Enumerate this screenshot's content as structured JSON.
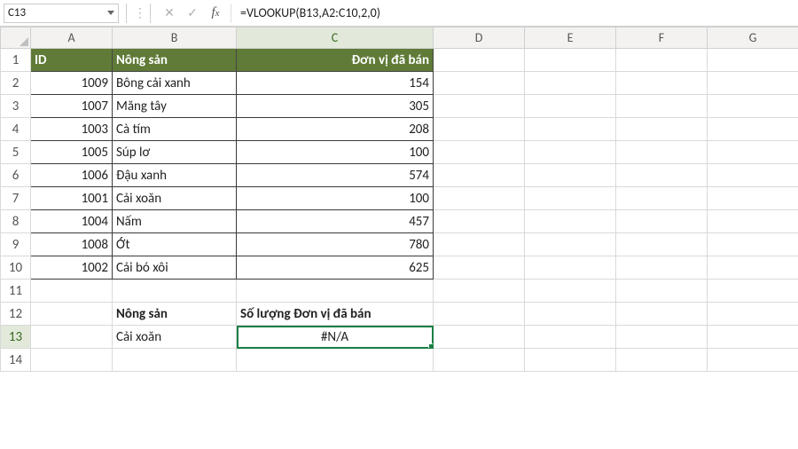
{
  "name_box": "C13",
  "formula_bar": "=VLOOKUP(B13,A2:C10,2,0)",
  "columns": [
    "A",
    "B",
    "C",
    "D",
    "E",
    "F",
    "G"
  ],
  "row_count": 14,
  "active": {
    "row": 13,
    "col": "C"
  },
  "headers": {
    "A": "ID",
    "B": "Nông sản",
    "C": "Đơn vị đã bán"
  },
  "data_rows": [
    {
      "id": "1009",
      "name": "Bông cải xanh",
      "units": "154"
    },
    {
      "id": "1007",
      "name": "Măng tây",
      "units": "305"
    },
    {
      "id": "1003",
      "name": "Cà tím",
      "units": "208"
    },
    {
      "id": "1005",
      "name": "Súp lơ",
      "units": "100"
    },
    {
      "id": "1006",
      "name": "Đậu xanh",
      "units": "574"
    },
    {
      "id": "1001",
      "name": "Cải xoăn",
      "units": "100"
    },
    {
      "id": "1004",
      "name": "Nấm",
      "units": "457"
    },
    {
      "id": "1008",
      "name": "Ớt",
      "units": "780"
    },
    {
      "id": "1002",
      "name": "Cải bó xôi",
      "units": "625"
    }
  ],
  "lookup": {
    "label_B": "Nông sản",
    "label_C": "Số lượng Đơn vị đã bán",
    "value_B": "Cải xoăn",
    "result_C": "#N/A"
  },
  "chart_data": {
    "type": "table",
    "columns": [
      "ID",
      "Nông sản",
      "Đơn vị đã bán"
    ],
    "rows": [
      [
        1009,
        "Bông cải xanh",
        154
      ],
      [
        1007,
        "Măng tây",
        305
      ],
      [
        1003,
        "Cà tím",
        208
      ],
      [
        1005,
        "Súp lơ",
        100
      ],
      [
        1006,
        "Đậu xanh",
        574
      ],
      [
        1001,
        "Cải xoăn",
        100
      ],
      [
        1004,
        "Nấm",
        457
      ],
      [
        1008,
        "Ớt",
        780
      ],
      [
        1002,
        "Cải bó xôi",
        625
      ]
    ]
  }
}
